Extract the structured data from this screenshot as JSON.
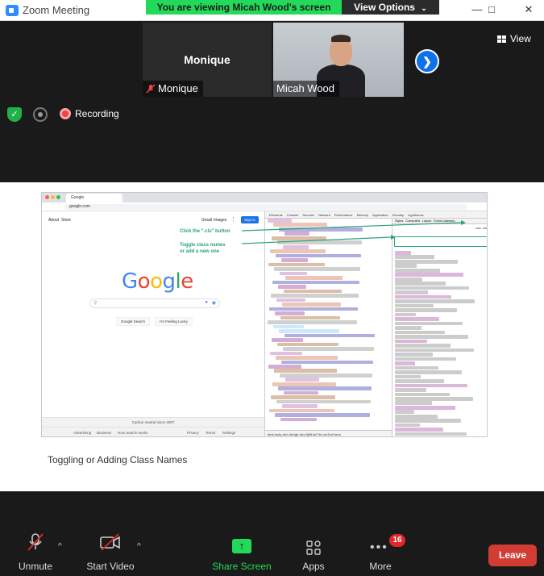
{
  "window": {
    "title": "Zoom Meeting",
    "icon": "zoom-camera-icon"
  },
  "banner": {
    "text": "You are viewing Micah Wood's screen",
    "view_options": "View Options",
    "color": "#23d959"
  },
  "participants": [
    {
      "name_big": "Monique",
      "label": "Monique",
      "muted": true
    },
    {
      "label": "Micah Wood"
    }
  ],
  "top_bar": {
    "view_label": "View",
    "recording_label": "Recording"
  },
  "shared_screen": {
    "browser": {
      "tab_title": "Google",
      "url": "google.com",
      "top_links": [
        "About",
        "Store"
      ],
      "right_links": [
        "Gmail",
        "Images"
      ],
      "signin": "Sign in",
      "logo_letters": [
        {
          "ch": "G",
          "color": "#4285f4"
        },
        {
          "ch": "o",
          "color": "#ea4335"
        },
        {
          "ch": "o",
          "color": "#fbbc05"
        },
        {
          "ch": "g",
          "color": "#4285f4"
        },
        {
          "ch": "l",
          "color": "#34a853"
        },
        {
          "ch": "e",
          "color": "#ea4335"
        }
      ],
      "buttons": [
        "Google Search",
        "I'm Feeling Lucky"
      ],
      "carbon": "Carbon neutral since 2007",
      "footer_left": [
        "Advertising",
        "Business",
        "How Search works"
      ],
      "footer_right": [
        "Privacy",
        "Terms",
        "Settings"
      ]
    },
    "annotations": {
      "line1": "Click the \".cls\" button",
      "line2a": "Toggle class names",
      "line2b": "or add a new one"
    },
    "devtools": {
      "tabs": [
        "Elements",
        "Console",
        "Sources",
        "Network",
        "Performance",
        "Memory",
        "Application",
        "Security",
        "Lighthouse"
      ],
      "styles_tabs": [
        "Styles",
        "Computed",
        "Layout",
        "Event Listeners"
      ],
      "filter": ":hov .cls",
      "bottom": "html  body  div.L3eUgb  div.o3j99.ikrT4e.om7nvf  form"
    },
    "caption": "Toggling or Adding Class Names"
  },
  "toolbar": {
    "unmute": "Unmute",
    "start_video": "Start Video",
    "share_screen": "Share Screen",
    "apps": "Apps",
    "more": "More",
    "more_badge": "16",
    "leave": "Leave"
  }
}
